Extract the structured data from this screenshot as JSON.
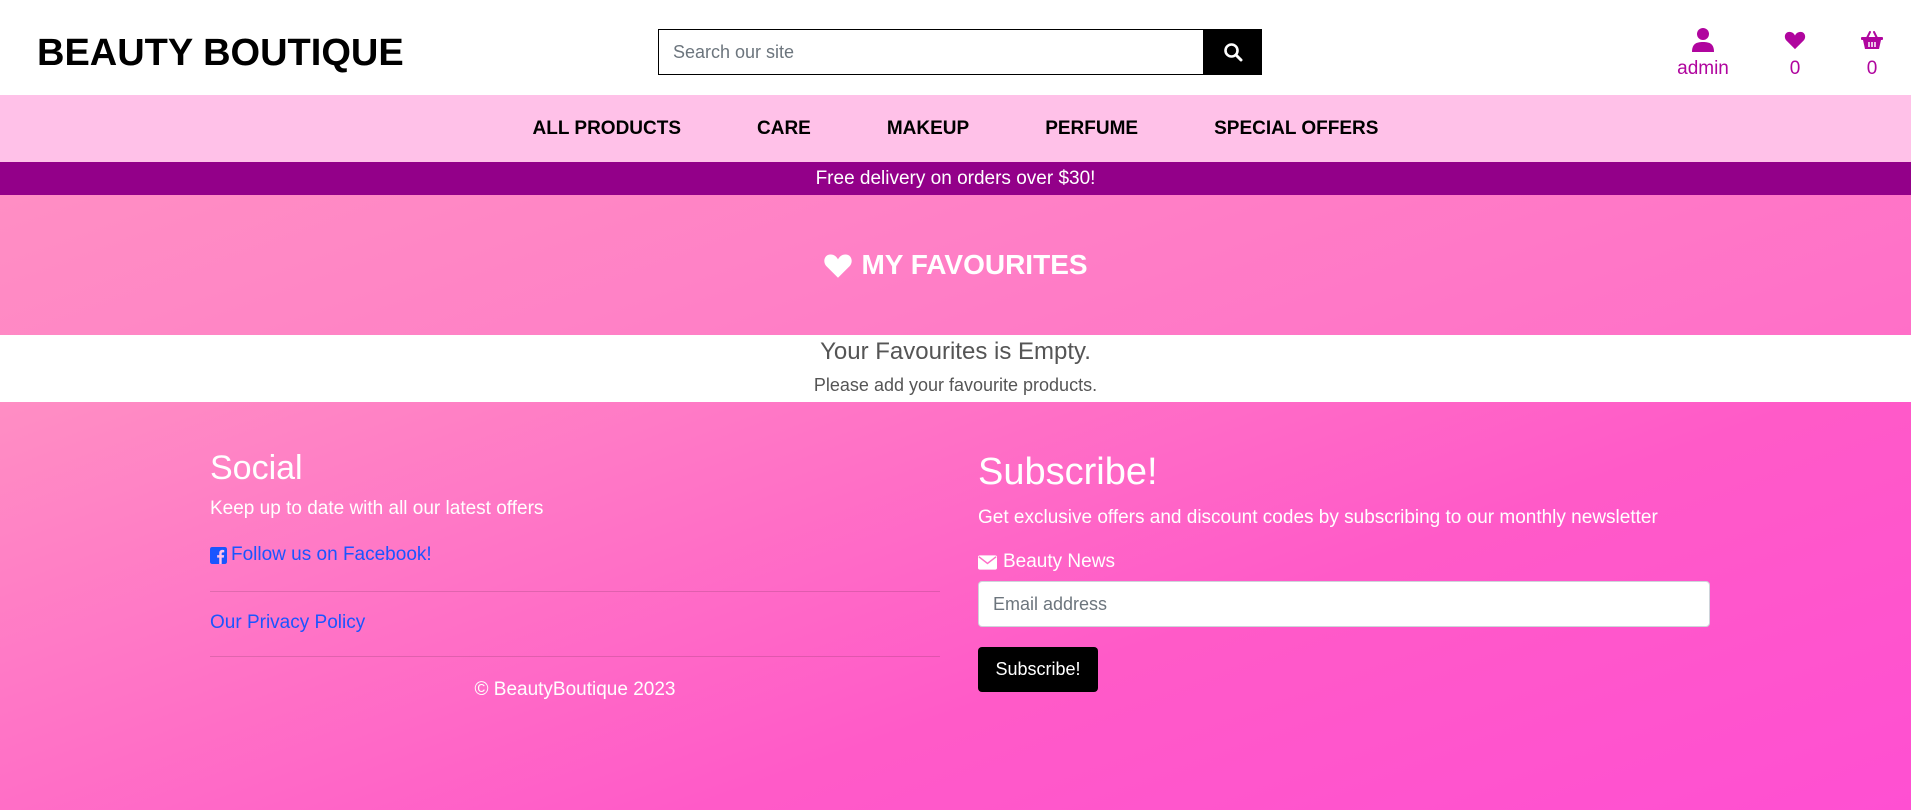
{
  "header": {
    "logo": "BEAUTY BOUTIQUE",
    "search_placeholder": "Search our site",
    "account_label": "admin",
    "favourites_count": "0",
    "cart_count": "0"
  },
  "nav": {
    "items": [
      "ALL PRODUCTS",
      "CARE",
      "MAKEUP",
      "PERFUME",
      "SPECIAL OFFERS"
    ]
  },
  "banner": {
    "text": "Free delivery on orders over $30!"
  },
  "page": {
    "title": "MY FAVOURITES",
    "empty_title": "Your Favourites is Empty.",
    "empty_text": "Please add your favourite products."
  },
  "footer": {
    "social_heading": "Social",
    "social_text": "Keep up to date with all our latest offers",
    "facebook_link": "Follow us on Facebook!",
    "privacy_link": "Our Privacy Policy",
    "copyright": "© BeautyBoutique 2023",
    "subscribe_heading": "Subscribe!",
    "subscribe_text": "Get exclusive offers and discount codes by subscribing to our monthly newsletter",
    "newsletter_label": "Beauty News",
    "email_placeholder": "Email address",
    "subscribe_button": "Subscribe!"
  },
  "colors": {
    "accent": "#b0059e",
    "nav_bg": "#ffc1e8",
    "banner_bg": "#930089",
    "link": "#1a55ff"
  },
  "icons": [
    "search-icon",
    "user-icon",
    "heart-icon",
    "basket-icon",
    "facebook-icon",
    "envelope-icon"
  ]
}
